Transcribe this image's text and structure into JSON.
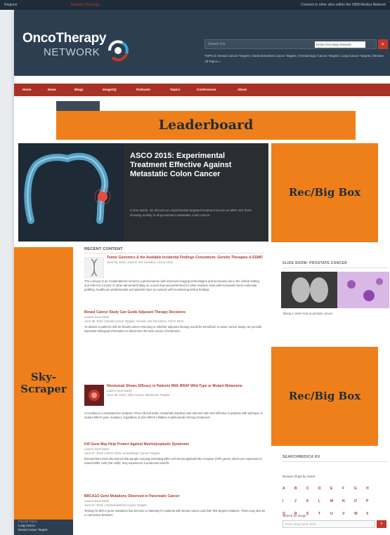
{
  "topbar": {
    "select": "Regions",
    "middle": "Targeted Oncology",
    "right": "Connect to other sites within the UBM Medica Network"
  },
  "header": {
    "logo_top": "OncoTherapy",
    "logo_sub": "NETWORK",
    "search_placeholder": "Search For",
    "search_dropdown": "Entire Oncology Network",
    "search_button": "⌕",
    "topics": "TOPICS: Breast Cancer Targets | Gastrointestinal Cancer Targets | Hematologic Cancer Targets | Lung Cancer Targets | Browse All Topics »"
  },
  "nav": [
    "Home",
    "News",
    "Blogs",
    "ImageXQ",
    "Podcasts",
    "Topics",
    "Conferences",
    "About"
  ],
  "ads": {
    "leaderboard": "Leaderboard",
    "rec_big_box_1": "Rec/Big Box",
    "rec_big_box_2": "Rec/Big Box",
    "skyscraper": "Sky-Scraper"
  },
  "hero": {
    "title": "ASCO 2015: Experimental Treatment Effective Against Metastatic Colon Cancer",
    "desc": "In this article, we discuss an experimental targeted treatment known as MEK-162 that's showing activity in drug-resistant metastatic colon cancer."
  },
  "recent": {
    "heading": "RECENT CONTENT",
    "articles": [
      {
        "title": "Tumor Genomics & the Available Incidental Findings Conundrum: Genetic Therapies & ESMO",
        "meta": "June 09, 2015 | Cancer and Genetics, ASCO 2015",
        "body": "The concept of an 'incidentaloma' became a phenomenon with improved imaging technologies and increased use in the clinical setting, and refers to a tumor or other abnormal finding on a scan that was performed for other reasons. Now with increased tumor molecular profiling, healthcare professionals and patients have to contend with incidental germline findings."
      },
      {
        "title": "Breast Cancer Study Can Guide Adjuvant Therapy Decisions",
        "meta": "Lauren Suva Davis",
        "meta2": "June 08, 2015 | Breast Cancer Targets, Genetic and Genomics, ASCO 2015",
        "body": "To assess a patient's risk for breast cancer returning or whether adjuvant therapy would be beneficial, a newer cancer assay can provide important biological information to determine the best course of treatment."
      },
      {
        "title": "Nivolumab Shows Efficacy in Patients With BRAF Wild-Type or Mutant Melanoma",
        "meta": "Lauren Suva Davis",
        "meta2": "June 08, 2015 | Skin Cancer, Melanoma Targets",
        "body": "According to a retrospective analysis of four clinical trials, nivolumab (Opdivo) was deemed safe and effective in patients with wild-type or mutant BRAF gene mutation, regardless of prior BRAF inhibitor or ipilimumab (Yervoy) treatment."
      },
      {
        "title": "Kill Gene May Help Protect Against Myelodysplastic Syndrome",
        "meta": "Lauren Suva Davis",
        "meta2": "June 07, 2015 | ASCO 2015, Hematologic Cancer Targets",
        "body": "Researchers have discovered that people carrying activating killer-cell immunoglobulin-like receptor (KIR) genes, which are expressed in natural killer cells (NK cells), may experience a protective benefit."
      },
      {
        "title": "BRCA1/2 Gene Mutations Observed in Pancreatic Cancer",
        "meta": "Lauren Suva Davis",
        "meta2": "June 07, 2015 | Gastrointestinal Cancer Targets",
        "body": "Testing for BRCA gene mutations has become a mainstay for patients with breast cancer and their first-degree relatives. There may also be a connection between"
      }
    ]
  },
  "sidebar": {
    "slide_show_heading": "SLIDE SHOW: PROSTATE CANCER",
    "slide_caption": "Taking a closer look at prostate cancer",
    "searchmedica_heading": "SEARCHMEDICA RX",
    "browse_label": "Browse drugs by name:",
    "letters": [
      "A",
      "B",
      "C",
      "D",
      "E",
      "F",
      "G",
      "H",
      "I",
      "J",
      "K",
      "L",
      "M",
      "N",
      "O",
      "P",
      "Q",
      "R",
      "S",
      "T",
      "U",
      "V",
      "W",
      "X",
      "Y",
      "Z"
    ],
    "search_label": "Search for drugs:",
    "drug_placeholder": "Enter drug name here",
    "drug_button": "⌕"
  },
  "topics_box": {
    "heading": "Popular Topics",
    "items": [
      "Lung Cancer",
      "Breast Cancer Targets"
    ]
  },
  "colors": {
    "header": "#2c3e50",
    "nav": "#a93226",
    "ad_orange": "#ef7f1a",
    "link_red": "#b03a2e"
  }
}
